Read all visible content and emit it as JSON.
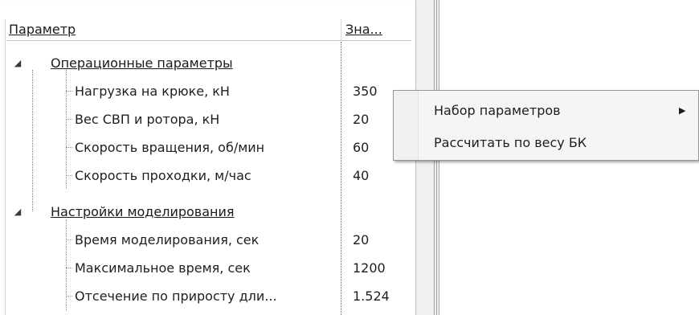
{
  "grid": {
    "header": {
      "param": "Параметр",
      "value": "Зна..."
    },
    "categories": [
      {
        "label": "Операционные параметры",
        "items": [
          {
            "label": "Нагрузка на крюке, кН",
            "value": "350"
          },
          {
            "label": "Вес СВП и ротора, кН",
            "value": "20"
          },
          {
            "label": "Скорость вращения, об/мин",
            "value": "60"
          },
          {
            "label": "Скорость проходки, м/час",
            "value": "40"
          }
        ]
      },
      {
        "label": "Настройки моделирования",
        "items": [
          {
            "label": "Время моделирования, сек",
            "value": "20"
          },
          {
            "label": "Максимальное время, сек",
            "value": "1200"
          },
          {
            "label": "Отсечение по приросту дли...",
            "value": "1.524"
          }
        ]
      }
    ]
  },
  "context_menu": {
    "items": [
      {
        "label": "Набор параметров",
        "has_submenu": true
      },
      {
        "label": "Рассчитать по весу БК",
        "has_submenu": false
      }
    ]
  },
  "icons": {
    "expanded": "collapse-triangle-icon",
    "submenu": "submenu-arrow-icon"
  }
}
